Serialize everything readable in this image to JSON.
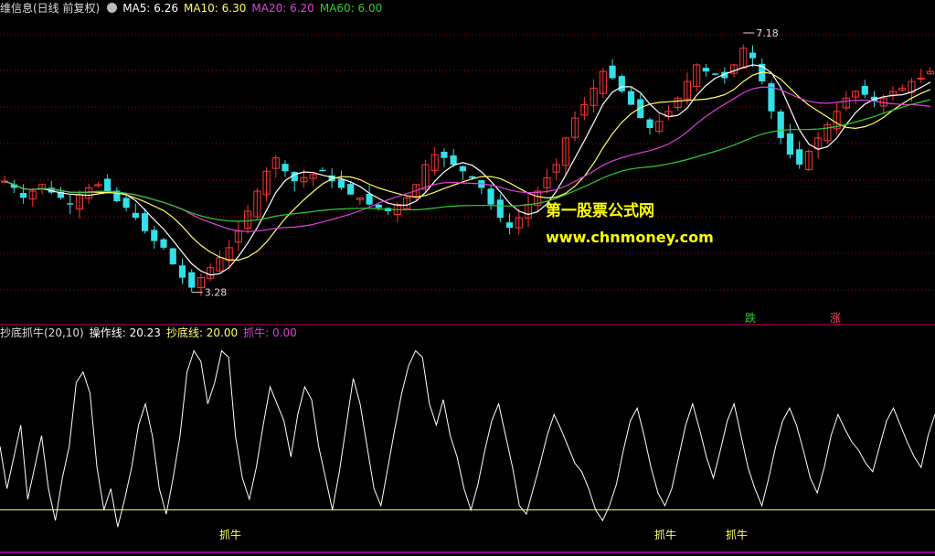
{
  "top_header": {
    "title": "维信息(日线 前复权)",
    "ma5": "MA5: 6.26",
    "ma10": "MA10: 6.30",
    "ma20": "MA20: 6.20",
    "ma60": "MA60: 6.00"
  },
  "bottom_header": {
    "title": "抄底抓牛(20,10)",
    "op_line": "操作线: 20.23",
    "bottom_line": "抄底线: 20.00",
    "zhuaniu": "抓牛: 0.00"
  },
  "annotations": {
    "high_label": "7.18",
    "low_label": "3.28",
    "fall_label": "跌",
    "rise_label": "涨",
    "signal_label": "抓牛"
  },
  "watermark": {
    "line1": "第一股票公式网",
    "line2": "www.chnmoney.com"
  },
  "colors": {
    "up": "#ff3333",
    "down": "#33e0e8",
    "ma5": "#ffffff",
    "ma10": "#ffff66",
    "ma20": "#e040e0",
    "ma60": "#33cc33",
    "grid": "#b00020",
    "oscillator": "#ffffff",
    "bottom_line": "#ffff66"
  },
  "chart_data": [
    {
      "type": "candlestick",
      "price_range": [
        3.0,
        7.4
      ],
      "annotated_high": 7.18,
      "annotated_low": 3.28,
      "ma_latest": {
        "MA5": 6.26,
        "MA10": 6.3,
        "MA20": 6.2,
        "MA60": 6.0
      },
      "close_path": [
        4.95,
        4.85,
        4.7,
        4.8,
        4.9,
        4.78,
        4.7,
        4.6,
        4.75,
        4.85,
        4.9,
        4.8,
        4.65,
        4.55,
        4.4,
        4.2,
        4.05,
        3.95,
        3.7,
        3.5,
        3.35,
        3.5,
        3.65,
        3.8,
        3.95,
        4.2,
        4.5,
        4.8,
        5.1,
        5.3,
        5.1,
        4.95,
        5.0,
        5.05,
        5.1,
        4.95,
        4.85,
        4.75,
        4.7,
        4.6,
        4.55,
        4.5,
        4.6,
        4.7,
        4.9,
        5.2,
        5.35,
        5.3,
        5.2,
        5.1,
        5.0,
        4.85,
        4.6,
        4.4,
        4.25,
        4.4,
        4.6,
        4.8,
        5.0,
        5.2,
        5.6,
        5.9,
        6.1,
        6.35,
        6.6,
        6.5,
        6.3,
        6.1,
        5.9,
        5.75,
        5.85,
        6.0,
        6.2,
        6.45,
        6.7,
        6.6,
        6.55,
        6.5,
        6.7,
        6.95,
        6.8,
        6.45,
        6.0,
        5.6,
        5.35,
        5.2,
        5.4,
        5.6,
        5.8,
        6.0,
        6.2,
        6.3,
        6.25,
        6.15,
        6.2,
        6.3,
        6.35,
        6.45,
        6.5,
        6.6
      ]
    },
    {
      "type": "line",
      "title": "抄底抓牛(20,10)",
      "range": [
        0,
        100
      ],
      "bottom_line": 20.0,
      "op_line_latest": 20.23,
      "zhuaniu_latest": 0.0,
      "signals": [
        "抓牛",
        "抓牛",
        "抓牛"
      ],
      "values": [
        50,
        30,
        45,
        60,
        25,
        40,
        55,
        30,
        15,
        35,
        50,
        80,
        85,
        75,
        40,
        20,
        30,
        12,
        25,
        40,
        60,
        70,
        55,
        30,
        18,
        35,
        55,
        85,
        95,
        90,
        70,
        80,
        95,
        92,
        55,
        35,
        25,
        40,
        60,
        78,
        70,
        62,
        45,
        65,
        78,
        72,
        50,
        35,
        20,
        38,
        60,
        82,
        70,
        50,
        30,
        22,
        40,
        58,
        75,
        88,
        95,
        92,
        70,
        60,
        72,
        55,
        45,
        30,
        20,
        32,
        48,
        62,
        70,
        55,
        40,
        22,
        18,
        30,
        42,
        55,
        65,
        58,
        50,
        42,
        38,
        30,
        20,
        15,
        22,
        32,
        48,
        62,
        68,
        55,
        40,
        28,
        22,
        30,
        45,
        60,
        70,
        58,
        45,
        35,
        48,
        62,
        70,
        55,
        40,
        30,
        22,
        35,
        50,
        62,
        68,
        60,
        48,
        35,
        28,
        40,
        55,
        65,
        58,
        52,
        48,
        42,
        38,
        50,
        62,
        68,
        60,
        52,
        45,
        40,
        55,
        65
      ]
    }
  ]
}
